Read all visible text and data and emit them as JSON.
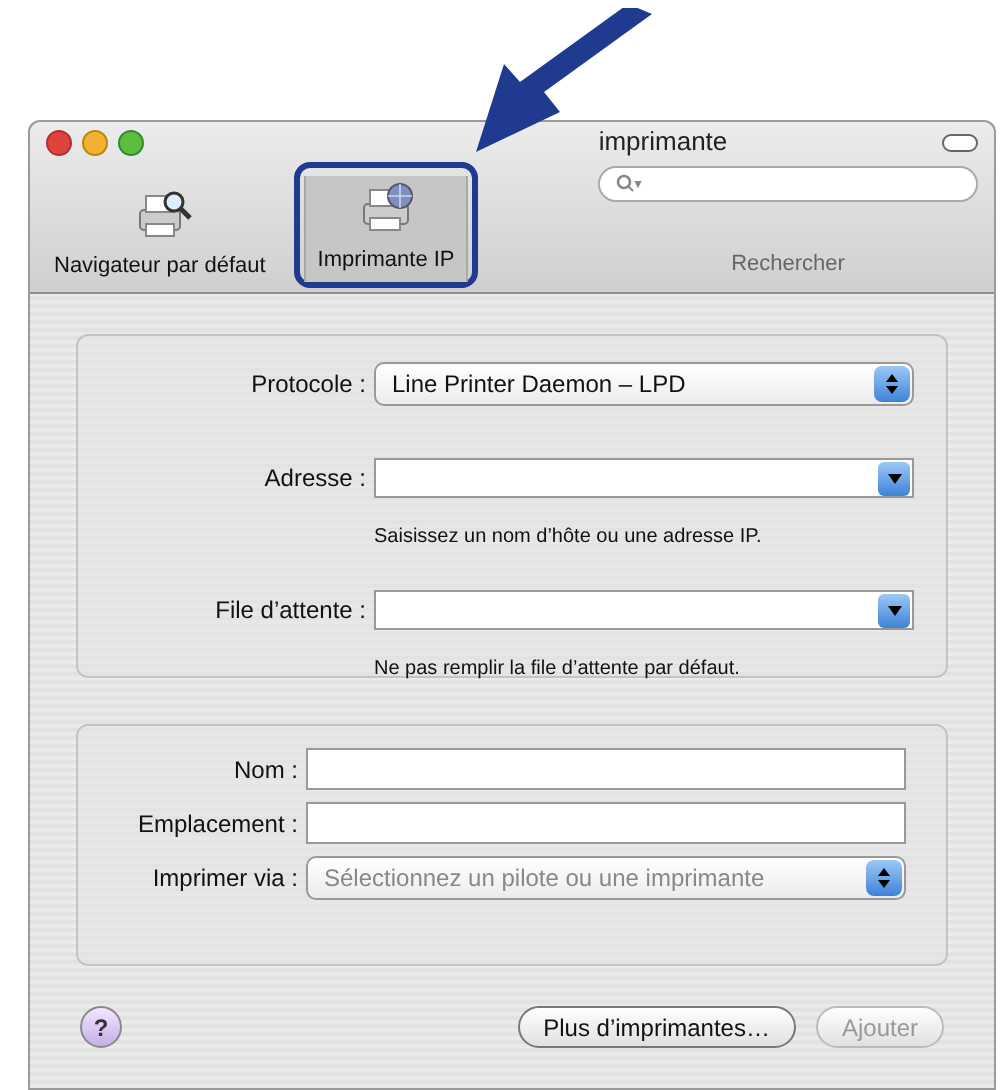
{
  "window": {
    "title": "imprimante"
  },
  "toolbar": {
    "items": [
      {
        "label": "Navigateur par défaut",
        "selected": false,
        "kind": "browser"
      },
      {
        "label": "Imprimante IP",
        "selected": true,
        "kind": "ip"
      }
    ],
    "search": {
      "label": "Rechercher"
    }
  },
  "connection": {
    "protocol": {
      "label": "Protocole :",
      "value": "Line Printer Daemon – LPD"
    },
    "fields": [
      {
        "label": "Adresse :",
        "hint": "Saisissez un nom d’hôte ou une adresse IP."
      },
      {
        "label": "File d’attente :",
        "hint": "Ne pas remplir la file d’attente par défaut."
      }
    ]
  },
  "details": {
    "fields": [
      {
        "label": "Nom :"
      },
      {
        "label": "Emplacement :"
      }
    ],
    "print_using": {
      "label": "Imprimer via :",
      "placeholder": "Sélectionnez un pilote ou une imprimante"
    }
  },
  "footer": {
    "help": "?",
    "buttons": [
      {
        "label": "Plus d’imprimantes…",
        "disabled": false
      },
      {
        "label": "Ajouter",
        "disabled": true
      }
    ]
  }
}
